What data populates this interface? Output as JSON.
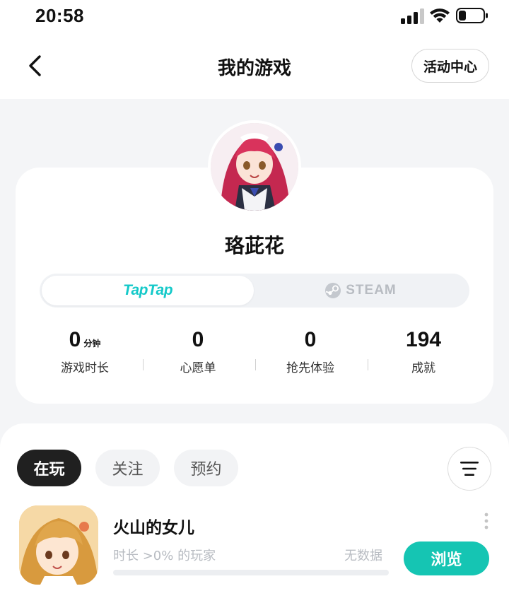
{
  "status_bar": {
    "time": "20:58"
  },
  "nav": {
    "title": "我的游戏",
    "activity_label": "活动中心"
  },
  "profile": {
    "username": "珞茈花"
  },
  "platforms": {
    "taptap_label": "TapTap",
    "steam_label": "STEAM",
    "selected": "TapTap"
  },
  "stats": [
    {
      "value": "0",
      "unit": "分钟",
      "label": "游戏时长"
    },
    {
      "value": "0",
      "unit": "",
      "label": "心愿单"
    },
    {
      "value": "0",
      "unit": "",
      "label": "抢先体验"
    },
    {
      "value": "194",
      "unit": "",
      "label": "成就"
    }
  ],
  "tabs": [
    {
      "label": "在玩",
      "active": true
    },
    {
      "label": "关注",
      "active": false
    },
    {
      "label": "预约",
      "active": false
    }
  ],
  "games": [
    {
      "name": "火山的女儿",
      "meta": "时长 >0% 的玩家",
      "status": "无数据",
      "progress": 0,
      "action_label": "浏览"
    }
  ],
  "colors": {
    "accent": "#14c9c9",
    "browse_button": "#15c5b3",
    "active_tab": "#202020"
  }
}
